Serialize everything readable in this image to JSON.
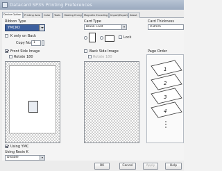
{
  "window": {
    "title": "Datacard SP35 Printing Preferences"
  },
  "tabs": [
    "Device Option",
    "Printing Area",
    "Color",
    "Tools",
    "Heating Energy",
    "Magnetic Encoding",
    "Import/Export",
    "About"
  ],
  "ribbon": {
    "label": "Ribbon Type",
    "value": "YMCKO"
  },
  "k_only": {
    "label": "K only on Back"
  },
  "copy": {
    "label": "Copy No:",
    "value": "1"
  },
  "card_type": {
    "label": "Card Type",
    "value": "Blank Card",
    "lock_label": "Lock"
  },
  "card_thickness": {
    "label": "Card Thickness",
    "value": "0.8mm"
  },
  "front": {
    "label": "Front Side Image",
    "rotate_label": "Rotate 180"
  },
  "back": {
    "label": "Back Side Image",
    "rotate_label": "Rotate 180"
  },
  "page_order": {
    "label": "Page Order",
    "pages": [
      "1",
      "2",
      "3",
      "4"
    ]
  },
  "using_ymc": {
    "label": "Using YMC"
  },
  "resin_k": {
    "label": "Using Resin K",
    "value": "Disable"
  },
  "buttons": {
    "ok": "OK",
    "cancel": "Cancel",
    "apply": "Apply",
    "help": "Help"
  }
}
